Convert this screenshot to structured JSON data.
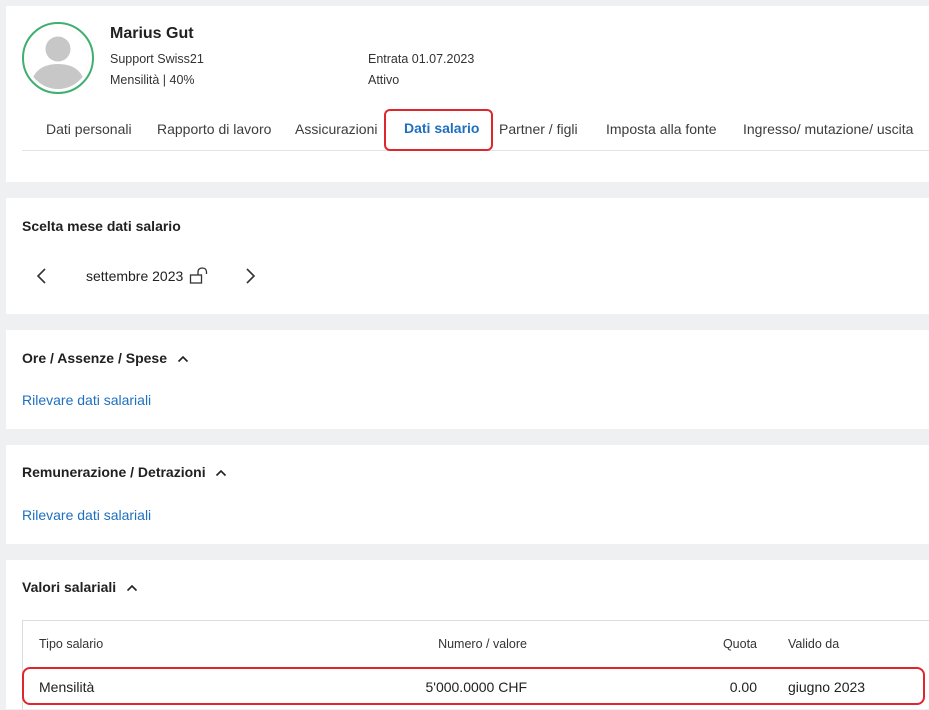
{
  "employee": {
    "name": "Marius Gut",
    "company": "Support Swiss21",
    "monthly": "Mensilità | 40%",
    "entry": "Entrata 01.07.2023",
    "status": "Attivo"
  },
  "tabs": [
    {
      "label": "Dati personali"
    },
    {
      "label": "Rapporto di lavoro"
    },
    {
      "label": "Assicurazioni"
    },
    {
      "label": "Dati salario",
      "active": true
    },
    {
      "label": "Partner / figli"
    },
    {
      "label": "Imposta alla fonte"
    },
    {
      "label": "Ingresso/ mutazione/ uscita"
    }
  ],
  "month_section": {
    "title": "Scelta mese dati salario",
    "month": "settembre 2023"
  },
  "ore_section": {
    "title": "Ore / Assenze / Spese",
    "link": "Rilevare dati salariali"
  },
  "rem_section": {
    "title": "Remunerazione / Detrazioni",
    "link": "Rilevare dati salariali"
  },
  "valori_section": {
    "title": "Valori salariali",
    "columns": [
      "Tipo salario",
      "Numero / valore",
      "Quota",
      "Valido da"
    ],
    "rows": [
      [
        "Mensilità",
        "5'000.0000 CHF",
        "0.00",
        "giugno 2023"
      ]
    ]
  },
  "colors": {
    "accent": "#1e6fbf",
    "highlight": "#e0262d",
    "avatar_ring": "#3eaf6e"
  }
}
